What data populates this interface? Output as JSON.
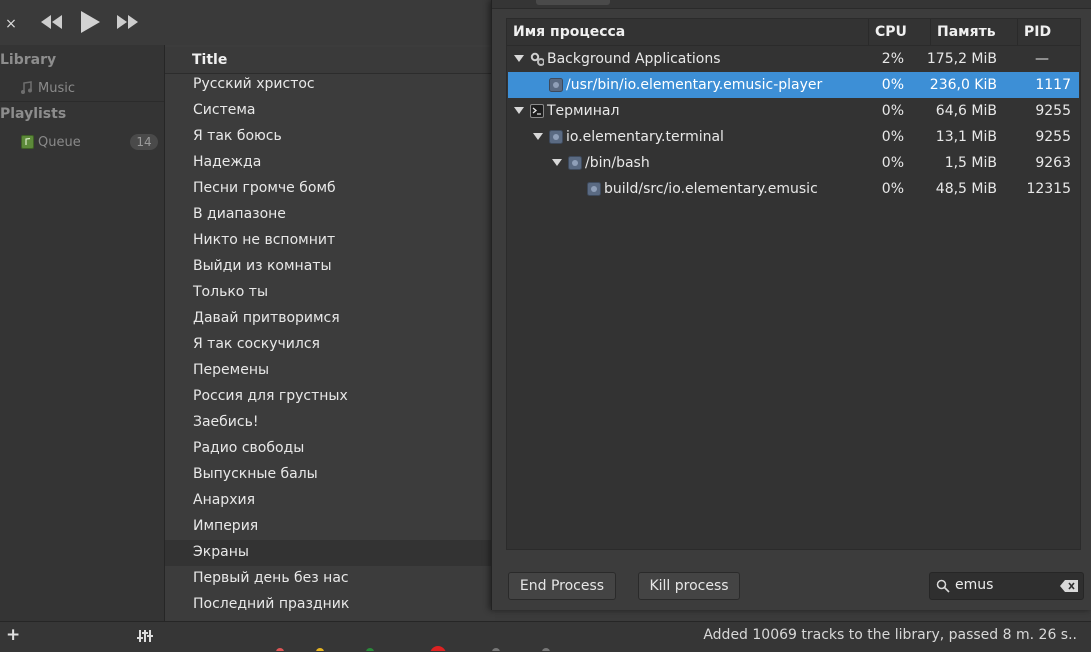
{
  "player": {
    "toolbar": {
      "close_glyph": "×"
    },
    "sidebar": {
      "library_header": "Library",
      "library_items": [
        {
          "label": "Music",
          "icon": "music-note-icon"
        }
      ],
      "playlists_header": "Playlists",
      "playlist_items": [
        {
          "label": "Queue",
          "icon": "queue-icon",
          "count": "14"
        }
      ]
    },
    "tracklist": {
      "column_title": "Title",
      "tracks": [
        "Русский христос",
        "Система",
        "Я так боюсь",
        "Надежда",
        "Песни громче бомб",
        "В диапазоне",
        "Никто не вспомнит",
        "Выйди из комнаты",
        "Только ты",
        "Давай притворимся",
        "Я так соскучился",
        "Перемены",
        "Россия для грустных",
        "Заебись!",
        "Радио свободы",
        "Выпускные балы",
        "Анархия",
        "Империя",
        "Экраны",
        "Первый день без нас",
        "Последний праздник"
      ],
      "selected_index": 18
    },
    "bottombar": {
      "add_glyph": "+",
      "status": "Added 10069 tracks to the library, passed  8 m. 26 s.."
    }
  },
  "monitor": {
    "columns": {
      "name": "Имя процесса",
      "cpu": "CPU",
      "memory": "Память",
      "pid": "PID"
    },
    "processes": [
      {
        "name": "Background Applications",
        "cpu": "2%",
        "memory": "175,2 MiB",
        "pid": "—",
        "depth": 0,
        "expanded": true,
        "icon": "gears-icon",
        "selected": false
      },
      {
        "name": "/usr/bin/io.elementary.emusic-player",
        "cpu": "0%",
        "memory": "236,0 KiB",
        "pid": "1117",
        "depth": 1,
        "expanded": false,
        "icon": "process-icon",
        "selected": true
      },
      {
        "name": "Терминал",
        "cpu": "0%",
        "memory": "64,6 MiB",
        "pid": "9255",
        "depth": 0,
        "expanded": true,
        "icon": "terminal-icon",
        "selected": false
      },
      {
        "name": "io.elementary.terminal",
        "cpu": "0%",
        "memory": "13,1 MiB",
        "pid": "9255",
        "depth": 1,
        "expanded": true,
        "icon": "process-icon",
        "selected": false
      },
      {
        "name": "/bin/bash",
        "cpu": "0%",
        "memory": "1,5 MiB",
        "pid": "9263",
        "depth": 2,
        "expanded": true,
        "icon": "process-icon",
        "selected": false
      },
      {
        "name": "build/src/io.elementary.emusic",
        "cpu": "0%",
        "memory": "48,5 MiB",
        "pid": "12315",
        "depth": 3,
        "expanded": false,
        "icon": "process-icon",
        "selected": false
      }
    ],
    "buttons": {
      "end_process": "End Process",
      "kill_process": "Kill process"
    },
    "search": {
      "value": "emus"
    },
    "colors": {
      "selection": "#3d8fd6"
    }
  }
}
